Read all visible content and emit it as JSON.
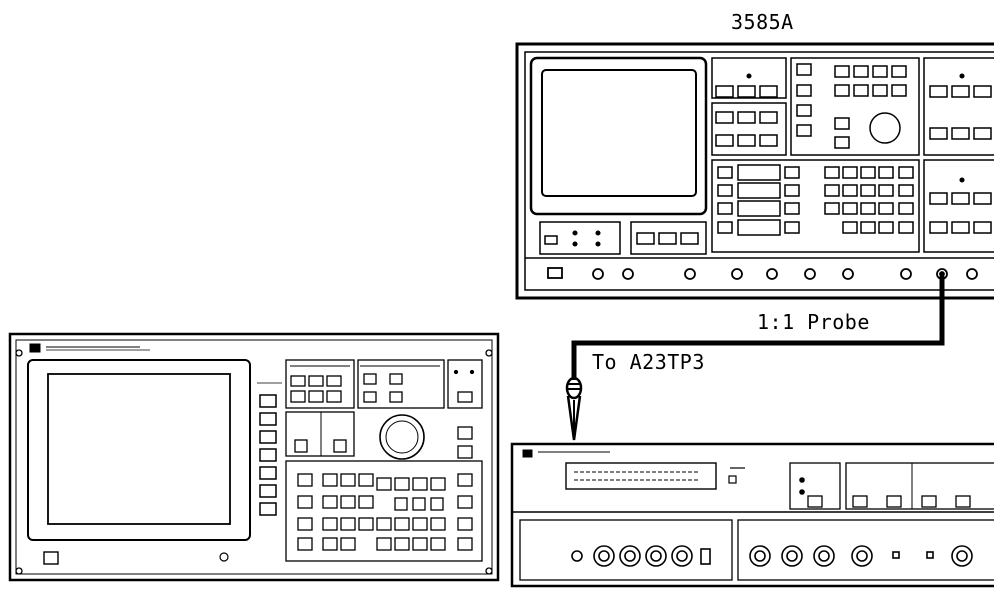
{
  "labels": {
    "analyzer_model": "3585A",
    "probe": "1:1 Probe",
    "probe_target": "To A23TP3"
  },
  "colors": {
    "ink": "#000000",
    "paper": "#ffffff"
  }
}
